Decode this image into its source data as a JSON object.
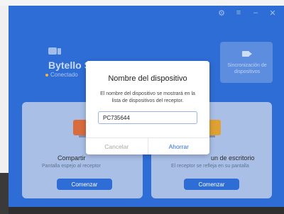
{
  "window": {
    "controls": [
      "⚙",
      "≡",
      "–",
      "✕"
    ]
  },
  "device": {
    "name": "Bytello Si",
    "status": "Conectado"
  },
  "sync": {
    "label": "Sincronización de dispositivos"
  },
  "cards": {
    "left": {
      "title": "Compartir",
      "subtitle": "Pantalla espejo al receptor",
      "button": "Comenzar"
    },
    "right": {
      "title": "un de escritorio",
      "subtitle": "El receptor se refleja en su pantalla",
      "button": "Comenzar"
    }
  },
  "dialog": {
    "title": "Nombre del dispositivo",
    "description": "El nombre del dispositivo se mostrará en la lista de dispositivos del receptor.",
    "input_value": "PC735644",
    "cancel_label": "Cancelar",
    "save_label": "Ahorrar"
  },
  "colors": {
    "app_blue": "#2f6dd6",
    "card_bg": "#a9bfe6",
    "accent_orange": "#d86c3e",
    "accent_yellow": "#dfa134"
  }
}
